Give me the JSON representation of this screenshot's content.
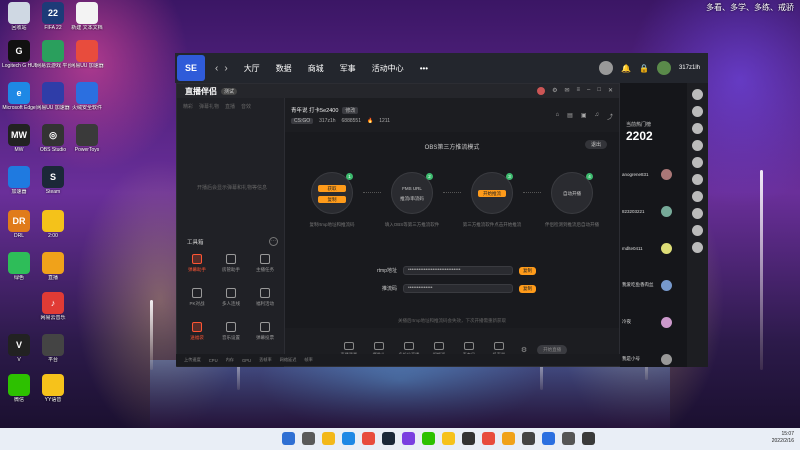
{
  "desktop": {
    "top_right_text": "多看、多学、多练、戒骄",
    "icons": [
      {
        "label": "回收站",
        "color": "#cfd8e3",
        "glyph": ""
      },
      {
        "label": "FIFA 22",
        "color": "#1d3b78",
        "glyph": "22"
      },
      {
        "label": "新建 文本文档",
        "color": "#f3f3f3",
        "glyph": ""
      },
      {
        "label": "Logitech G HUB",
        "color": "#111111",
        "glyph": "G"
      },
      {
        "label": "网易云游戏 平台",
        "color": "#2a9f5d",
        "glyph": ""
      },
      {
        "label": "网易UU 加速器",
        "color": "#e84c3d",
        "glyph": ""
      },
      {
        "label": "Microsoft Edge",
        "color": "#1e88e5",
        "glyph": "e"
      },
      {
        "label": "网易UU 加速器",
        "color": "#2f3da8",
        "glyph": ""
      },
      {
        "label": "火绒安全软件",
        "color": "#2b6fe0",
        "glyph": ""
      },
      {
        "label": "MW",
        "color": "#222222",
        "glyph": "MW"
      },
      {
        "label": "OBS Studio",
        "color": "#333333",
        "glyph": "◎"
      },
      {
        "label": "PowerToys",
        "color": "#3a3a3a",
        "glyph": ""
      },
      {
        "label": "加速器",
        "color": "#1f7ae0",
        "glyph": ""
      },
      {
        "label": "Steam",
        "color": "#1b2838",
        "glyph": "S"
      },
      {
        "label": "DRL",
        "color": "#e07b1a",
        "glyph": "DR"
      },
      {
        "label": "2:00",
        "color": "#f4c21a",
        "glyph": ""
      },
      {
        "label": "绿色",
        "color": "#2ebd59",
        "glyph": ""
      },
      {
        "label": "直播",
        "color": "#f0a21a",
        "glyph": ""
      },
      {
        "label": "网易云音乐",
        "color": "#e13b35",
        "glyph": "♪"
      },
      {
        "label": "V",
        "color": "#222222",
        "glyph": "V"
      },
      {
        "label": "平台",
        "color": "#444444",
        "glyph": ""
      },
      {
        "label": "微信",
        "color": "#2dc100",
        "glyph": ""
      },
      {
        "label": "YY语音",
        "color": "#f6c21b",
        "glyph": ""
      }
    ]
  },
  "titlebar": {
    "logo": "SE",
    "nav": [
      "大厅",
      "数据",
      "商城",
      "军事",
      "活动中心",
      "•••"
    ],
    "username": "317z1lh"
  },
  "streamer": {
    "brand": "直播伴侣",
    "version": "测试",
    "left_tabs": [
      "精彩",
      "弹幕礼物",
      "直播",
      "音效"
    ],
    "empty_text": "开播后会显示弹幕和礼物等信息",
    "tools_title": "工具箱",
    "tools": [
      {
        "label": "弹幕助手",
        "active": true
      },
      {
        "label": "房管助手",
        "active": false
      },
      {
        "label": "主播任务",
        "active": false
      },
      {
        "label": "PK对战",
        "active": false
      },
      {
        "label": "多人连线",
        "active": false
      },
      {
        "label": "福利活动",
        "active": false
      },
      {
        "label": "送福袋",
        "active": true
      },
      {
        "label": "音乐设置",
        "active": false
      },
      {
        "label": "弹幕投票",
        "active": false
      },
      {
        "label": "",
        "active": false
      },
      {
        "label": "",
        "active": false
      },
      {
        "label": "",
        "active": false
      }
    ],
    "room_title": "青年说 打卡5e2400",
    "room_tag": "修改",
    "game": "CS:GO",
    "room_stats": [
      "317z1h",
      "6888551",
      "1211"
    ],
    "obs": {
      "title": "OBS第三方推流模式",
      "exit": "退出",
      "steps": [
        {
          "num": "1",
          "line1": "获取",
          "line2": "复制",
          "desc": "复制rtmp地址和推流码"
        },
        {
          "num": "2",
          "line1": "FMS URL",
          "line2": "推流/串流码",
          "desc": "填入OBS等第三方推流软件"
        },
        {
          "num": "3",
          "line1": "开始推流",
          "line2": "",
          "desc": "第三方推流软件点击开始推流"
        },
        {
          "num": "4",
          "line1": "自动开播",
          "line2": "",
          "desc": "伴侣检测到推流后自动开播"
        }
      ],
      "rtmp_label": "rtmp地址",
      "rtmp_value": "••••••••••••••••••••••••••••••",
      "key_label": "推流码",
      "key_value": "••••••••••••••",
      "copy": "复制",
      "hint": "关播后rtmp地址和推流码会失效，下次开播需重新获取"
    },
    "bottom_items": [
      "直播背景",
      "摄像头",
      "多机位直播",
      "视频源",
      "麦克风",
      "扬声器"
    ],
    "start_button": "开始直播",
    "status_items": [
      "上传速度",
      "CPU",
      "内存",
      "GPU",
      "丢帧率",
      "网络延迟",
      "帧率"
    ]
  },
  "right_panel": {
    "title": "当前热门榜",
    "number": "2202",
    "users": [
      "anogrene831",
      "823203221",
      "mdlte0411",
      "我爱吃鱼香肉丝",
      "冷夜",
      "我是小号"
    ]
  },
  "taskbar": {
    "time": "15:07",
    "date": "2022/2/16",
    "icon_colors": [
      "#2f6fd3",
      "#5a5a5a",
      "#f3b81a",
      "#1e88e5",
      "#e84c3d",
      "#1b2838",
      "#7a3fe0",
      "#2dc100",
      "#f6c21b",
      "#333333",
      "#e84c3d",
      "#f0a21a",
      "#444444",
      "#2b6fe0",
      "#555555",
      "#3a3a3a"
    ]
  }
}
